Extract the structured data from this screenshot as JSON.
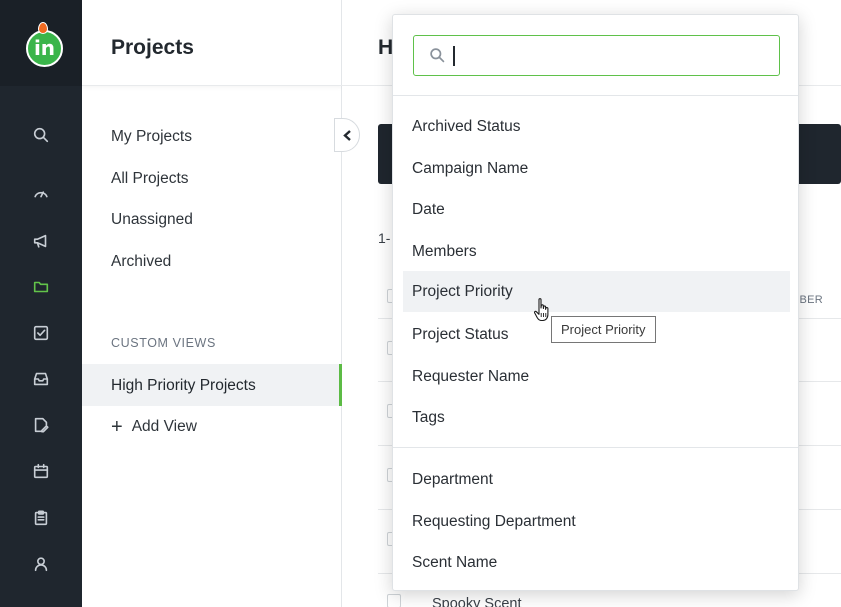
{
  "app": {
    "logo_text": "in",
    "rail_icons": [
      "search-icon",
      "dashboard-icon",
      "megaphone-icon",
      "folder-icon",
      "tasks-icon",
      "inbox-icon",
      "proof-icon",
      "calendar-icon",
      "clipboard-icon",
      "user-icon"
    ],
    "accent_color": "#5cbb45",
    "rail_color": "#1f262e"
  },
  "panel": {
    "title": "Projects",
    "links": [
      "My Projects",
      "All Projects",
      "Unassigned",
      "Archived"
    ],
    "section_label": "CUSTOM VIEWS",
    "active_view": "High Priority Projects",
    "add_view": "Add View",
    "add_view_plus": "+"
  },
  "main": {
    "title_partial": "H",
    "range_partial": "1-",
    "column_header_partial": "MBER",
    "bottom_row_partial": "Spooky Scent"
  },
  "dropdown": {
    "search": {
      "placeholder": "",
      "value": ""
    },
    "group1": [
      "Archived Status",
      "Campaign Name",
      "Date",
      "Members",
      "Project Priority",
      "Project Status",
      "Requester Name",
      "Tags"
    ],
    "group2": [
      "Department",
      "Requesting Department",
      "Scent Name"
    ],
    "hovered": "Project Priority"
  },
  "tooltip": {
    "text": "Project Priority"
  }
}
